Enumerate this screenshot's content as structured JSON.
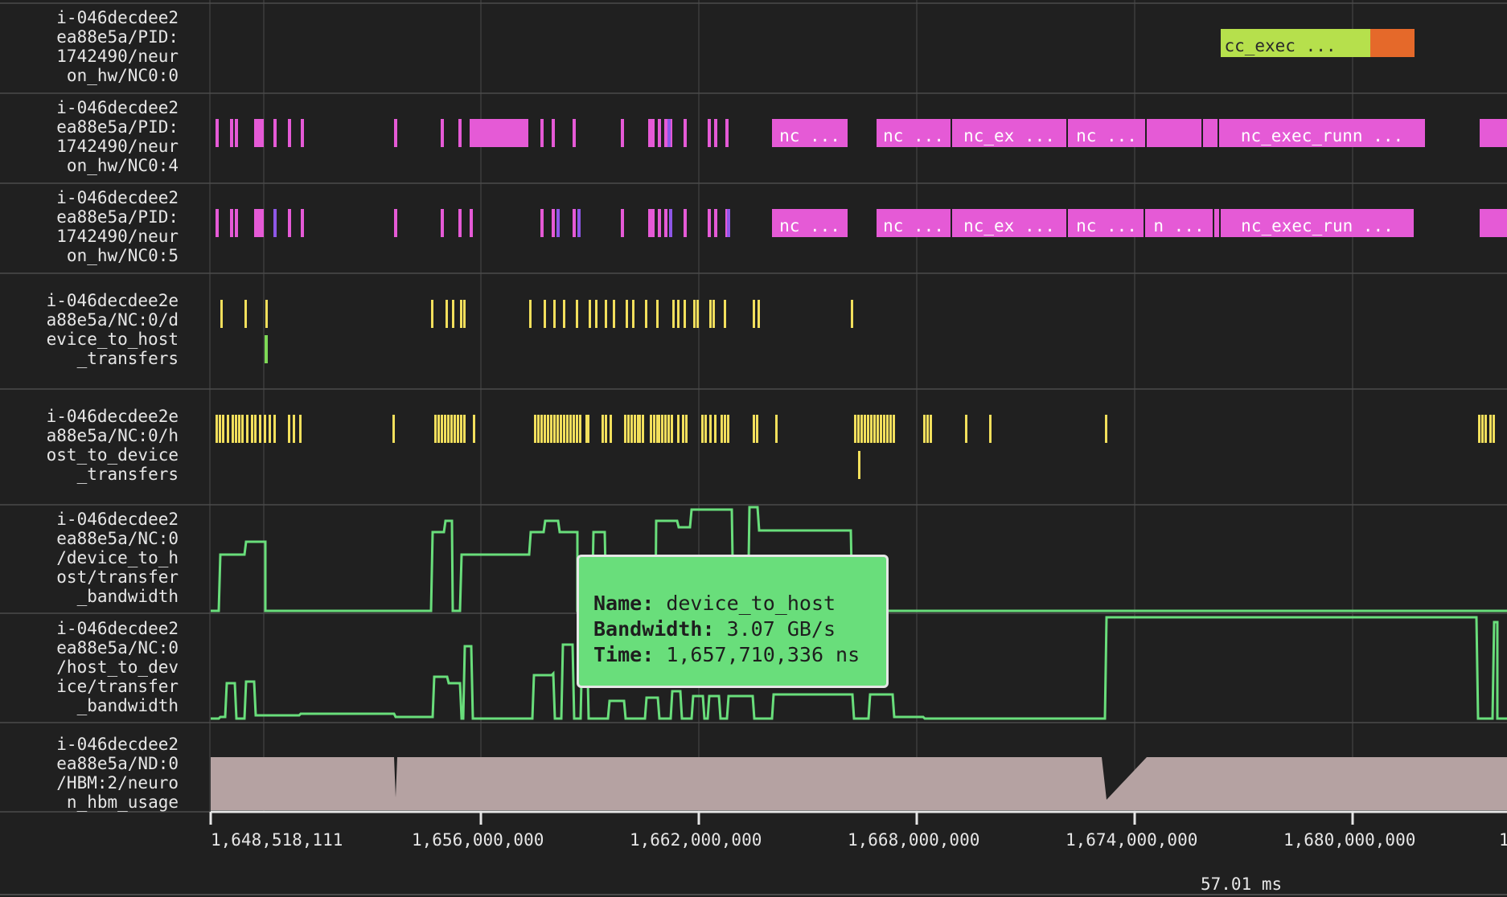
{
  "tracks": [
    {
      "label": "i-046decdee2\nea88e5a/PID:\n1742490/neur\non_hw/NC0:0"
    },
    {
      "label": "i-046decdee2\nea88e5a/PID:\n1742490/neur\non_hw/NC0:4"
    },
    {
      "label": "i-046decdee2\nea88e5a/PID:\n1742490/neur\non_hw/NC0:5"
    },
    {
      "label": "i-046decdee2e\na88e5a/NC:0/d\nevice_to_host\n_transfers"
    },
    {
      "label": "i-046decdee2e\na88e5a/NC:0/h\nost_to_device\n_transfers"
    },
    {
      "label": "i-046decdee2\nea88e5a/NC:0\n/device_to_h\nost/transfer\n_bandwidth"
    },
    {
      "label": "i-046decdee2\nea88e5a/NC:0\n/host_to_dev\nice/transfer\n_bandwidth"
    },
    {
      "label": "i-046decdee2\nea88e5a/ND:0\n/HBM:2/neuro\nn_hbm_usage"
    }
  ],
  "events": {
    "nc0_0": [
      "cc_exec ..."
    ],
    "nc0_4": [
      "nc ...",
      "nc ...",
      "nc_ex ...",
      "nc ...",
      "nc_exec_runn ..."
    ],
    "nc0_5": [
      "nc ...",
      "nc ...",
      "nc_ex ...",
      "nc ...",
      "n ...",
      "nc_exec_run ..."
    ]
  },
  "axis": {
    "ticks": [
      "1,648,518,111",
      "1,656,000,000",
      "1,662,000,000",
      "1,668,000,000",
      "1,674,000,000",
      "1,680,000,000",
      "1"
    ],
    "scale": "57.01 ms"
  },
  "tooltip": {
    "name_key": "Name:",
    "name_val": "device_to_host",
    "bw_key": "Bandwidth:",
    "bw_val": "3.07 GB/s",
    "time_key": "Time:",
    "time_val": "1,657,710,336 ns"
  },
  "colors": {
    "background": "#202020",
    "grid": "#4a4a4a",
    "exec_pink": "#e55ad6",
    "exec_purple": "#8e57e8",
    "cc_green": "#b6e04c",
    "cc_orange": "#e5692a",
    "transfer_yellow": "#f2df5c",
    "transfer_green": "#7ed957",
    "bandwidth_line": "#69de7b",
    "hbm_fill": "#b5a2a2"
  }
}
